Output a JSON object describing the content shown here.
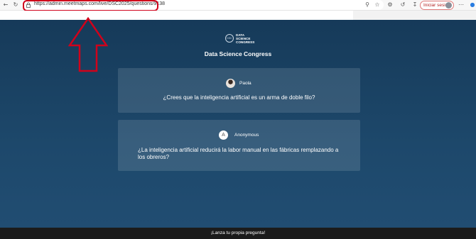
{
  "browser": {
    "url": "https://admin.meetmaps.com/live/DSC2025/questions/9138",
    "signin_label": "Iniciar sesión"
  },
  "logo": {
    "mark": "DSC",
    "text": "DATA\nSCIENCE\nCONGRESS"
  },
  "event": {
    "title": "Data Science Congress"
  },
  "questions": [
    {
      "author": "Paola",
      "text": "¿Crees que la inteligencia artificial es un arma de doble filo?"
    },
    {
      "author_initial": "A",
      "author": "Anonymous",
      "text": "¿La inteligencia artificial reducirá la labor manual en las fábricas remplazando a los obreros?"
    }
  ],
  "footer": {
    "cta": "¡Lanza tu propia pregunta!"
  },
  "colors": {
    "annotation": "#d0021b",
    "page_bg": "#1d486b",
    "footer_bg": "#1b1b1b"
  }
}
